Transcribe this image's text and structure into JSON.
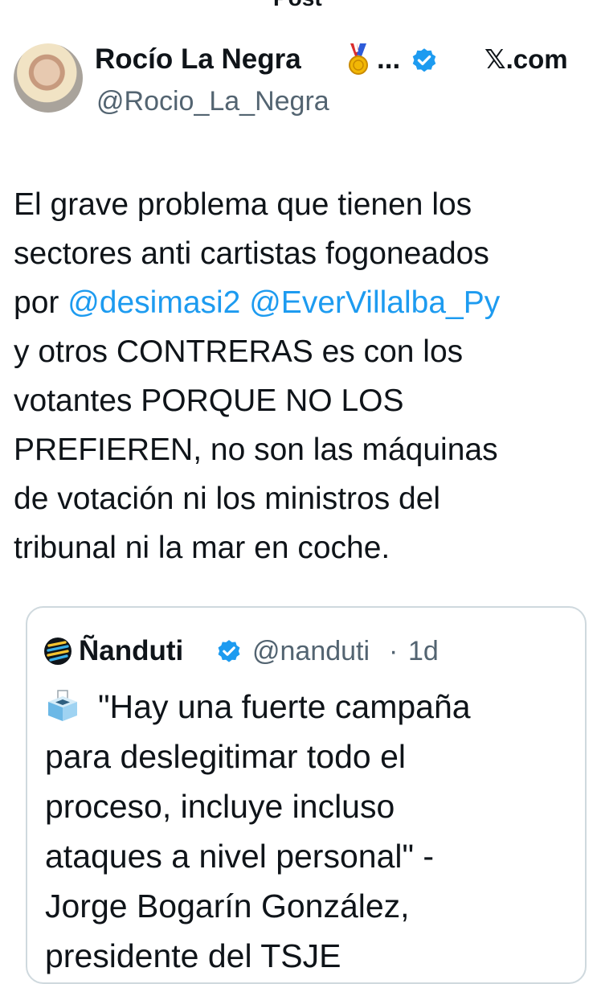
{
  "topbar": {
    "title": "Post"
  },
  "author": {
    "name": "Rocío La Negra",
    "ellipsis": "...",
    "handle": "@Rocio_La_Negra",
    "source": "𝕏.com",
    "icons": [
      "medal-icon",
      "verified-icon"
    ]
  },
  "tweet": {
    "lines": [
      [
        {
          "text": "El grave problema que tienen los"
        }
      ],
      [
        {
          "text": "sectores anti cartistas fogoneados"
        }
      ],
      [
        {
          "text": "por "
        },
        {
          "text": "@desimasi2",
          "mention": true
        },
        {
          "text": "  "
        },
        {
          "text": "@EverVillalba_Py",
          "mention": true
        }
      ],
      [
        {
          "text": "y otros CONTRERAS es con los"
        }
      ],
      [
        {
          "text": "votantes PORQUE NO LOS"
        }
      ],
      [
        {
          "text": "PREFIEREN, no son las máquinas"
        }
      ],
      [
        {
          "text": "de votación ni los ministros del"
        }
      ],
      [
        {
          "text": "tribunal ni la mar en coche."
        }
      ]
    ]
  },
  "quote": {
    "name": "Ñanduti",
    "handle": "@nanduti",
    "dot": "·",
    "time": "1d",
    "icons": [
      "nanduti-logo-icon",
      "verified-icon",
      "ballot-box-icon"
    ],
    "lines": [
      "\"Hay una fuerte campaña",
      "para deslegitimar todo el",
      "proceso, incluye incluso",
      "ataques a nivel personal\" -",
      "Jorge Bogarín González,",
      "presidente del TSJE"
    ]
  },
  "colors": {
    "text": "#0f1419",
    "secondary": "#536471",
    "link": "#1d9bf0",
    "border": "#cfd9de",
    "verified": "#1d9bf0"
  }
}
